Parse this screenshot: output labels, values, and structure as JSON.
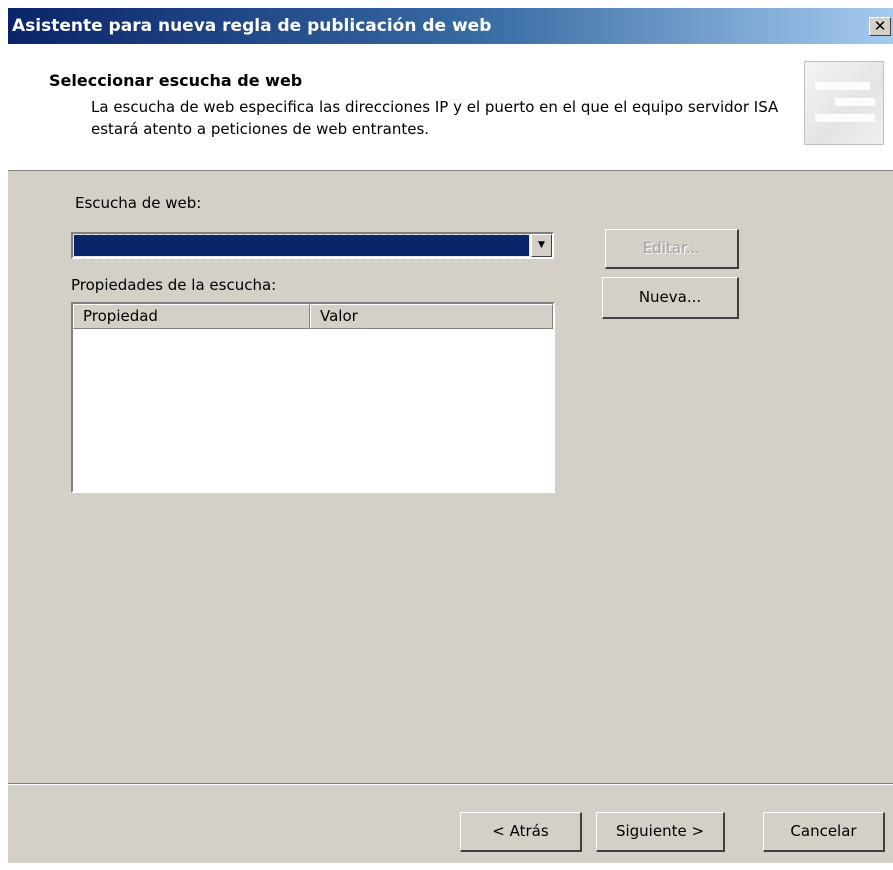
{
  "window": {
    "title": "Asistente para nueva regla de publicación de web",
    "close_glyph": "✕"
  },
  "header": {
    "title": "Seleccionar escucha de web",
    "description": "La escucha de web especifica las direcciones IP y el puerto en el que el equipo servidor ISA estará atento a peticiones de web entrantes."
  },
  "listener": {
    "label": "Escucha de web:",
    "selected_value": "",
    "dropdown_glyph": "▼"
  },
  "properties": {
    "label": "Propiedades de la escucha:",
    "columns": [
      "Propiedad",
      "Valor"
    ],
    "rows": []
  },
  "buttons": {
    "edit": "Editar...",
    "new": "Nueva...",
    "back": "< Atrás",
    "next": "Siguiente >",
    "cancel": "Cancelar"
  },
  "colors": {
    "title_start": "#0a246a",
    "title_end": "#a6caf0",
    "selection": "#0a246a",
    "face": "#d4d0c8"
  }
}
